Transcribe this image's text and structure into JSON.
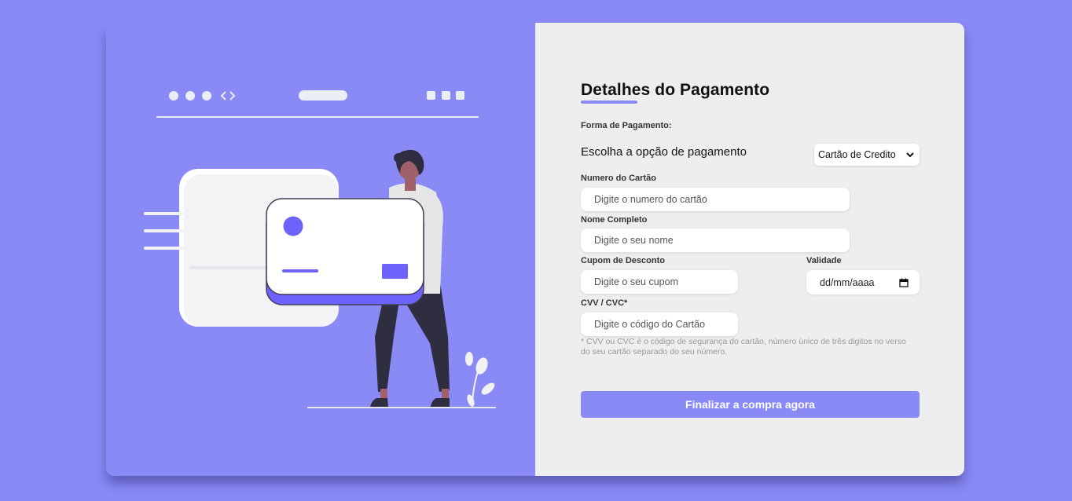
{
  "form": {
    "title": "Detalhes do Pagamento",
    "payment_method_label": "Forma de Pagamento:",
    "payment_prompt": "Escolha a opção de pagamento",
    "payment_select_value": "Cartão de Credito",
    "card_number_label": "Numero do Cartão",
    "card_number_placeholder": "Digite o numero do cartão",
    "name_label": "Nome Completo",
    "name_placeholder": "Digite o seu nome",
    "coupon_label": "Cupom de Desconto",
    "coupon_placeholder": "Digite o seu cupom",
    "validity_label": "Validade",
    "validity_placeholder": "dd/mm/aaaa",
    "cvv_label": "CVV / CVC*",
    "cvv_placeholder": "Digite o código do Cartão",
    "cvv_note": "* CVV ou CVC é o código de segurança do cartão, número único de três digitos no verso do seu cartão separado do seu número.",
    "submit_label": "Finalizar a compra agora"
  },
  "colors": {
    "accent": "#8a8af7",
    "illustration_purple": "#6c63ff",
    "panel_bg": "#eeeeee"
  },
  "icons": {
    "select_arrow": "chevron-down-icon",
    "date_picker": "calendar-icon"
  }
}
